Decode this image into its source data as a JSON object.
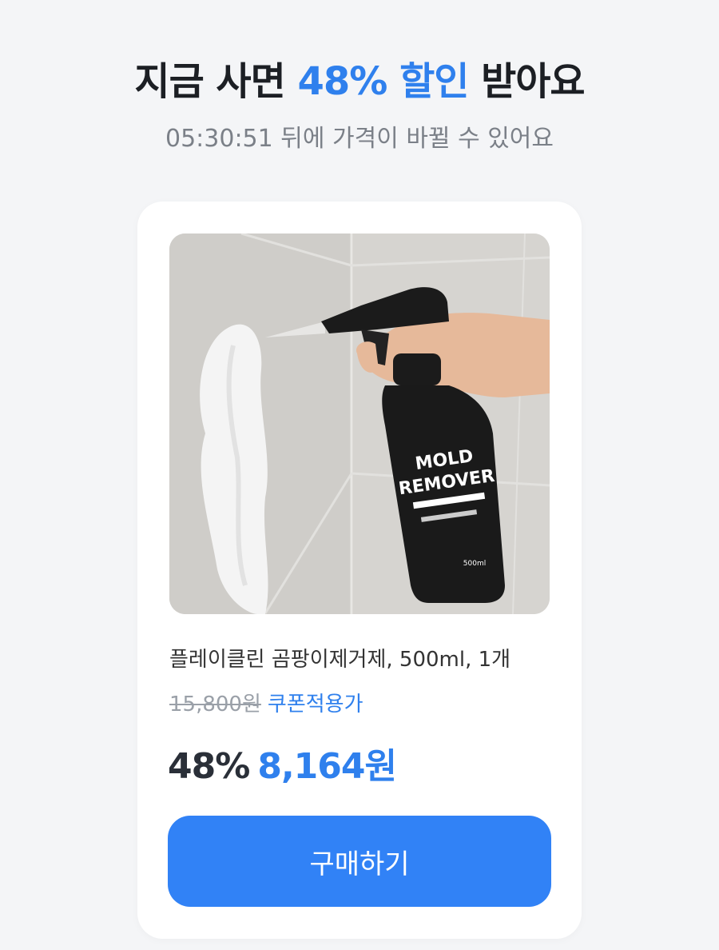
{
  "header": {
    "headline_prefix": "지금 사면 ",
    "headline_accent": "48% 할인",
    "headline_suffix": " 받아요",
    "subtitle": "05:30:51 뒤에 가격이 바뀔 수 있어요"
  },
  "product": {
    "image_icon": "product-photo",
    "bottle_label_line1": "MOLD",
    "bottle_label_line2": "REMOVER",
    "bottle_volume": "500ml",
    "name": "플레이클린 곰팡이제거제, 500ml, 1개",
    "original_price": "15,800원",
    "coupon_label": "쿠폰적용가",
    "discount": "48%",
    "sale_price": "8,164원"
  },
  "actions": {
    "buy_label": "구매하기"
  },
  "colors": {
    "accent": "#2f80ed",
    "button": "#3182f6",
    "background": "#f4f5f7"
  }
}
